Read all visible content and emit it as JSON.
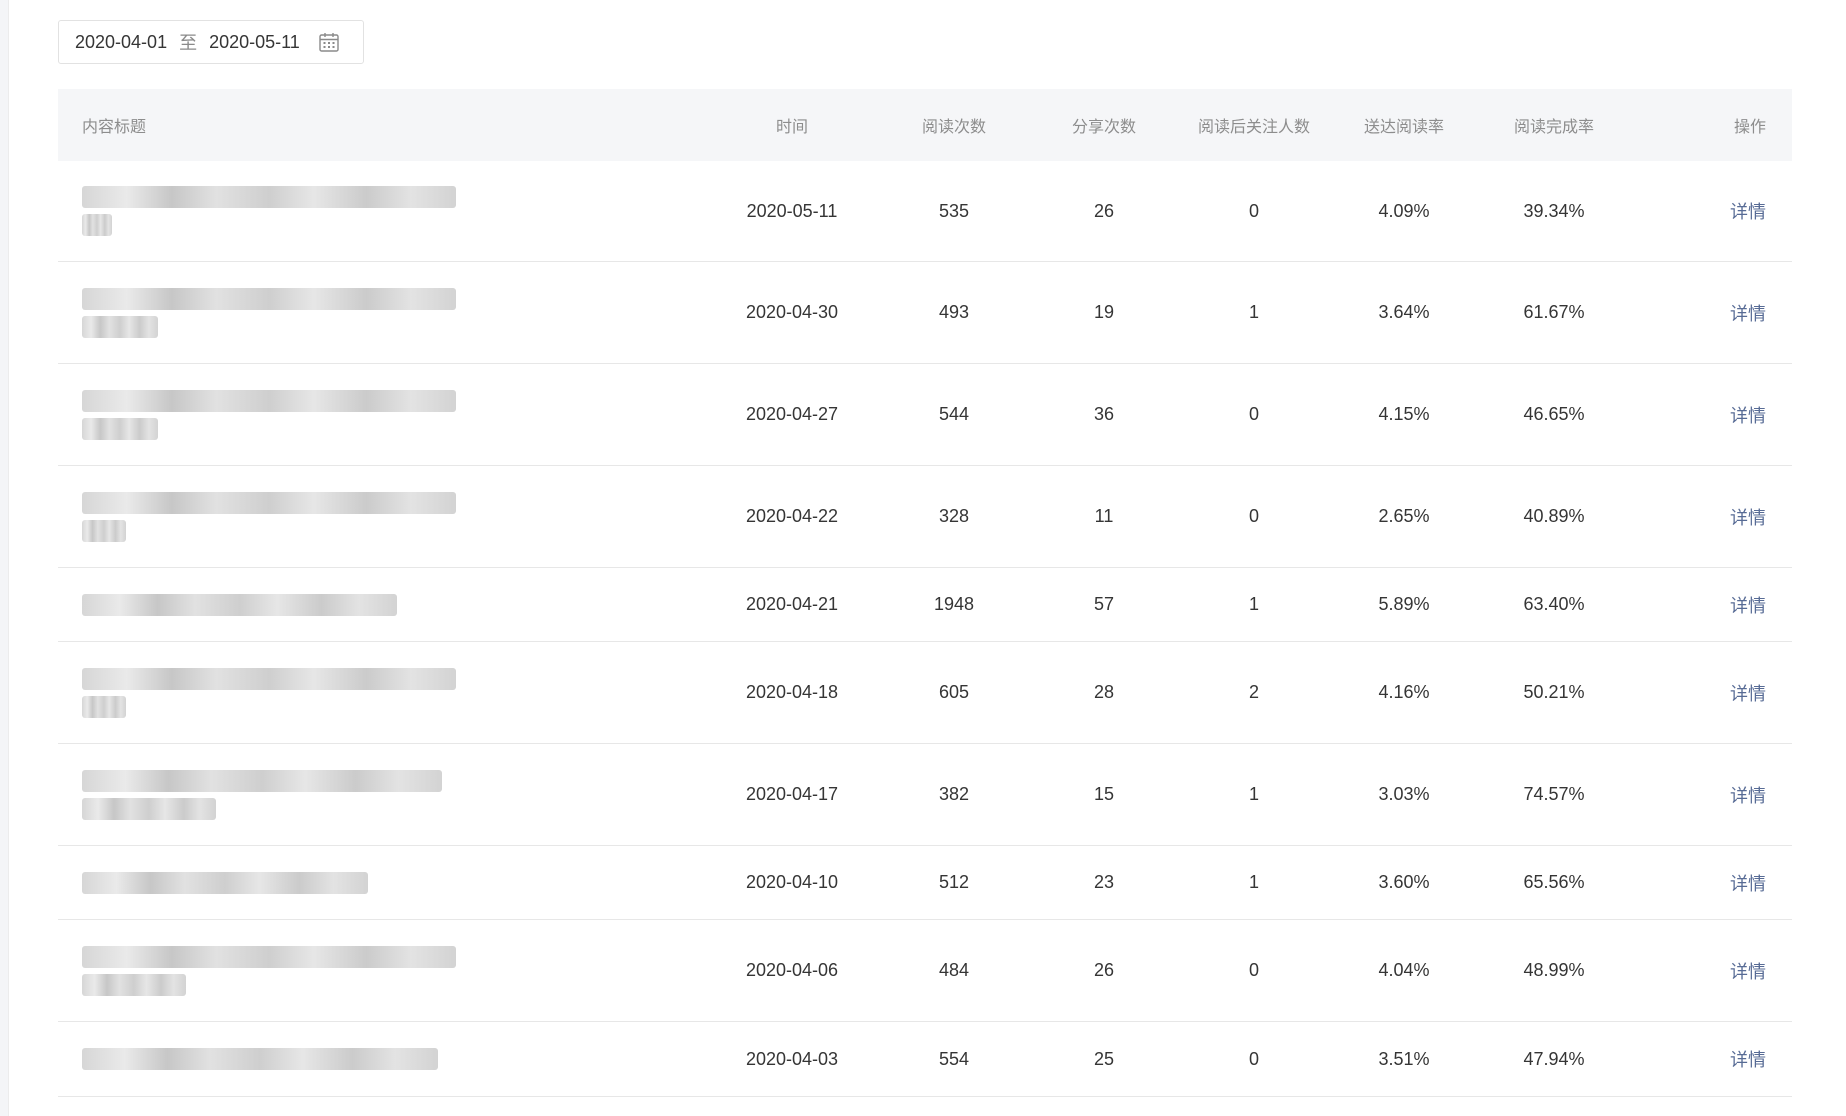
{
  "filter": {
    "start_date": "2020-04-01",
    "separator": "至",
    "end_date": "2020-05-11",
    "icon": "calendar-icon"
  },
  "table": {
    "columns": [
      "内容标题",
      "时间",
      "阅读次数",
      "分享次数",
      "阅读后关注人数",
      "送达阅读率",
      "阅读完成率",
      "操作"
    ],
    "rows": [
      {
        "date": "2020-05-11",
        "reads": "535",
        "shares": "26",
        "follows": "0",
        "delivery_rate": "4.09%",
        "completion_rate": "39.34%",
        "action": "详情"
      },
      {
        "date": "2020-04-30",
        "reads": "493",
        "shares": "19",
        "follows": "1",
        "delivery_rate": "3.64%",
        "completion_rate": "61.67%",
        "action": "详情"
      },
      {
        "date": "2020-04-27",
        "reads": "544",
        "shares": "36",
        "follows": "0",
        "delivery_rate": "4.15%",
        "completion_rate": "46.65%",
        "action": "详情"
      },
      {
        "date": "2020-04-22",
        "reads": "328",
        "shares": "11",
        "follows": "0",
        "delivery_rate": "2.65%",
        "completion_rate": "40.89%",
        "action": "详情"
      },
      {
        "date": "2020-04-21",
        "reads": "1948",
        "shares": "57",
        "follows": "1",
        "delivery_rate": "5.89%",
        "completion_rate": "63.40%",
        "action": "详情"
      },
      {
        "date": "2020-04-18",
        "reads": "605",
        "shares": "28",
        "follows": "2",
        "delivery_rate": "4.16%",
        "completion_rate": "50.21%",
        "action": "详情"
      },
      {
        "date": "2020-04-17",
        "reads": "382",
        "shares": "15",
        "follows": "1",
        "delivery_rate": "3.03%",
        "completion_rate": "74.57%",
        "action": "详情"
      },
      {
        "date": "2020-04-10",
        "reads": "512",
        "shares": "23",
        "follows": "1",
        "delivery_rate": "3.60%",
        "completion_rate": "65.56%",
        "action": "详情"
      },
      {
        "date": "2020-04-06",
        "reads": "484",
        "shares": "26",
        "follows": "0",
        "delivery_rate": "4.04%",
        "completion_rate": "48.99%",
        "action": "详情"
      },
      {
        "date": "2020-04-03",
        "reads": "554",
        "shares": "25",
        "follows": "0",
        "delivery_rate": "3.51%",
        "completion_rate": "47.94%",
        "action": "详情"
      }
    ]
  },
  "colors": {
    "link": "#576b95",
    "header_bg": "#f5f6f8",
    "divider": "#e7e7e7"
  }
}
